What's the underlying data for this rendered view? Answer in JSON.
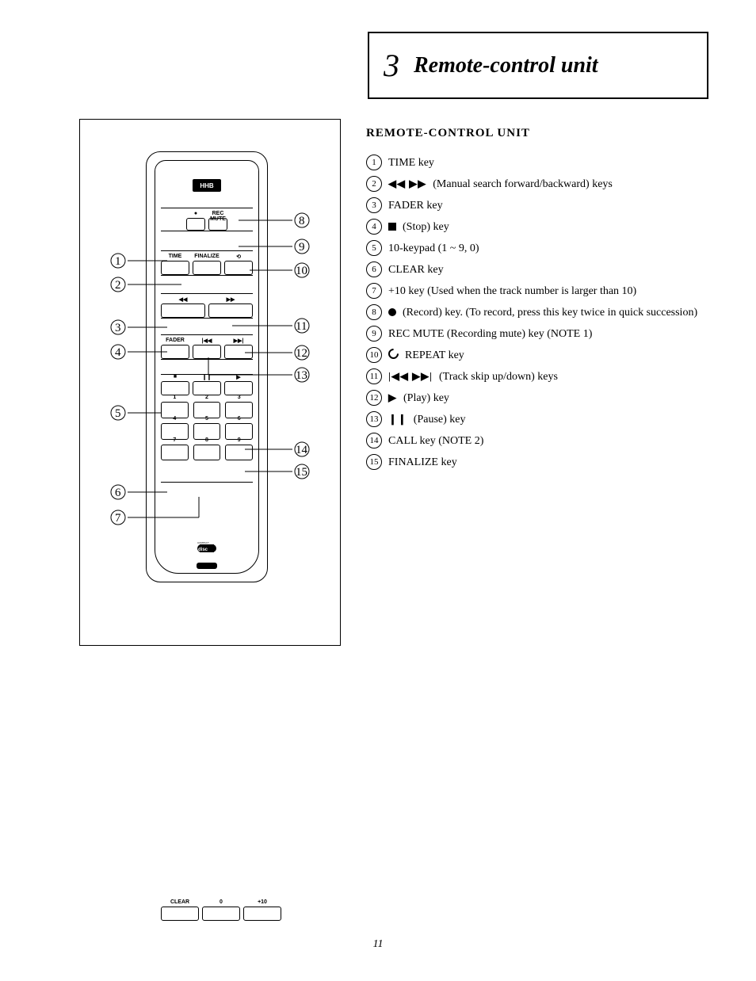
{
  "section": {
    "number": "3",
    "title": "Remote-control unit"
  },
  "remote": {
    "brand": "HHB",
    "disc_label": "COMPACT",
    "disc_sub": "DIGITAL AUDIO",
    "button_labels": {
      "record": "●",
      "time": "TIME",
      "rec_mute": "REC MUTE",
      "finalize": "FINALIZE",
      "repeat": "⟲",
      "rew": "◀◀",
      "ff": "▶▶",
      "fader": "FADER",
      "prev": "|◀◀",
      "next": "▶▶|",
      "stop": "■",
      "pause": "❙❙",
      "play": "▶"
    },
    "ten_key": [
      "1",
      "2",
      "3",
      "4",
      "5",
      "6",
      "7",
      "8",
      "9",
      "CLEAR",
      "0",
      "+10"
    ]
  },
  "callout_numbers": [
    "1",
    "2",
    "3",
    "4",
    "5",
    "6",
    "7",
    "8",
    "9",
    "10",
    "11",
    "12",
    "13",
    "14",
    "15"
  ],
  "list": {
    "heading": "REMOTE-CONTROL UNIT",
    "items": [
      {
        "n": "1",
        "mark": "",
        "text": "TIME key"
      },
      {
        "n": "2",
        "mark": "◀◀ ▶▶",
        "text": "(Manual search forward/backward) keys"
      },
      {
        "n": "3",
        "mark": "",
        "text": "FADER key"
      },
      {
        "n": "4",
        "mark": "■",
        "text": "(Stop) key"
      },
      {
        "n": "5",
        "mark": "",
        "text": "10-keypad (1 ~ 9, 0)"
      },
      {
        "n": "6",
        "mark": "",
        "text": "CLEAR key"
      },
      {
        "n": "7",
        "mark": "",
        "text": "+10 key (Used when the track number is larger than 10)"
      },
      {
        "n": "8",
        "mark": "●",
        "text": "(Record) key. (To record, press this key twice in quick succession)"
      },
      {
        "n": "9",
        "mark": "",
        "text": "REC MUTE (Recording mute) key (NOTE 1)"
      },
      {
        "n": "10",
        "mark": "⟲",
        "text": "REPEAT key"
      },
      {
        "n": "11",
        "mark": "|◀◀ ▶▶|",
        "text": "(Track skip up/down) keys"
      },
      {
        "n": "12",
        "mark": "▶",
        "text": "(Play) key"
      },
      {
        "n": "13",
        "mark": "❙❙",
        "text": "(Pause) key"
      },
      {
        "n": "14",
        "mark": "",
        "text": "CALL key (NOTE 2)"
      },
      {
        "n": "15",
        "mark": "",
        "text": "FINALIZE key"
      }
    ]
  },
  "page_number": "11"
}
